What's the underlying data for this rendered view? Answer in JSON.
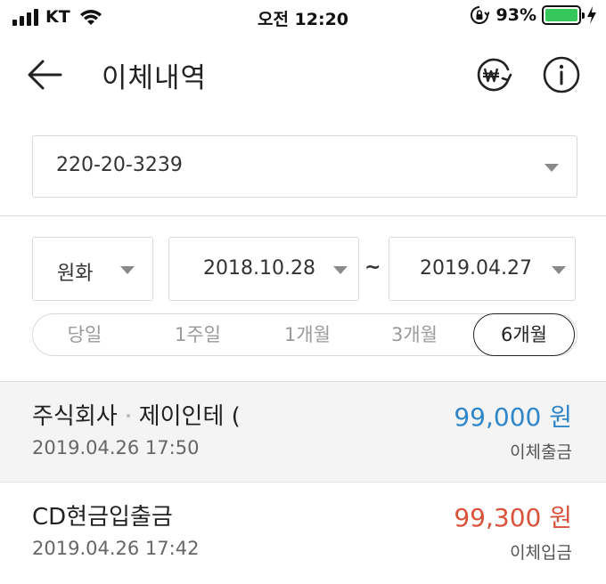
{
  "status_bar": {
    "carrier": "KT",
    "time": "오전 12:20",
    "battery": "93%",
    "battery_level": 0.93,
    "battery_color": "#35c759"
  },
  "header": {
    "title": "이체내역",
    "back_icon": "arrow-left-icon",
    "exchange_icon": "won-exchange-icon",
    "info_icon": "info-icon"
  },
  "account": {
    "value": "220-20-3239"
  },
  "filters": {
    "currency": "원화",
    "date_from": "2018.10.28",
    "separator": "~",
    "date_to": "2019.04.27"
  },
  "period": {
    "options": [
      "당일",
      "1주일",
      "1개월",
      "3개월",
      "6개월"
    ],
    "selected": "6개월"
  },
  "transactions": [
    {
      "name_part1": "주식회사",
      "name_part2": "제이인테 (",
      "datetime": "2019.04.26 17:50",
      "amount": "99,000 원",
      "type": "이체출금",
      "amount_color": "#2f86c8"
    },
    {
      "name": "CD현금입출금",
      "datetime": "2019.04.26 17:42",
      "amount": "99,300 원",
      "type": "이체입금",
      "amount_color": "#d9533c"
    }
  ]
}
